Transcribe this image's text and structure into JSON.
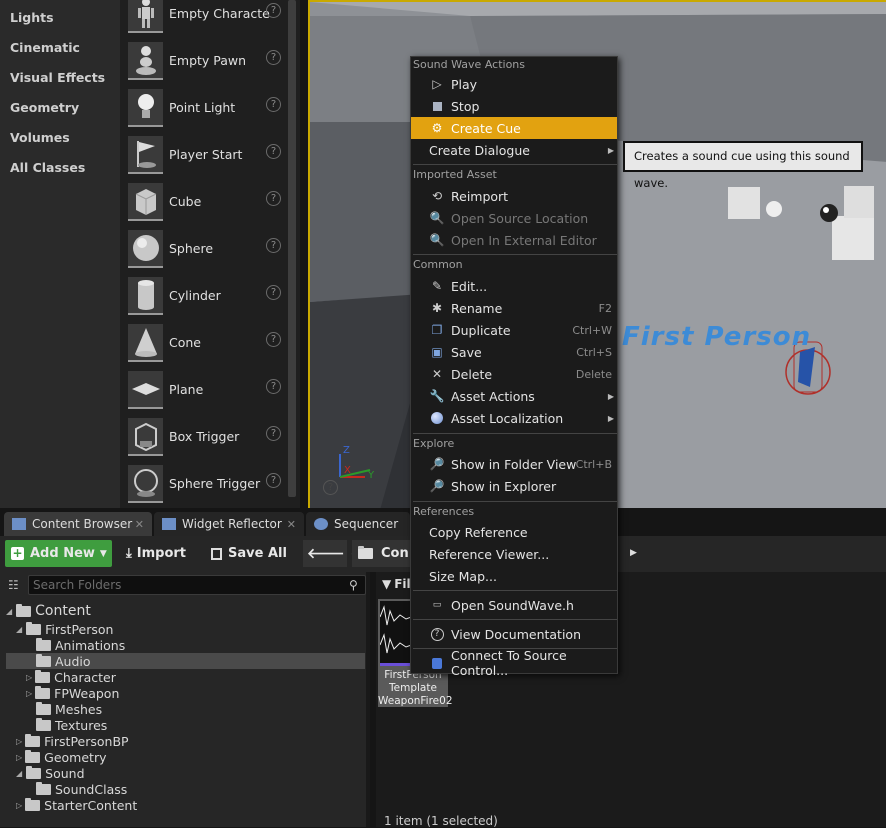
{
  "categories": [
    "Lights",
    "Cinematic",
    "Visual Effects",
    "Geometry",
    "Volumes",
    "All Classes"
  ],
  "place_items": [
    {
      "label": "Empty Characte",
      "icon": "character-icon"
    },
    {
      "label": "Empty Pawn",
      "icon": "pawn-icon"
    },
    {
      "label": "Point Light",
      "icon": "lightbulb-icon"
    },
    {
      "label": "Player Start",
      "icon": "flag-icon"
    },
    {
      "label": "Cube",
      "icon": "cube-icon"
    },
    {
      "label": "Sphere",
      "icon": "sphere-icon"
    },
    {
      "label": "Cylinder",
      "icon": "cylinder-icon"
    },
    {
      "label": "Cone",
      "icon": "cone-icon"
    },
    {
      "label": "Plane",
      "icon": "plane-icon"
    },
    {
      "label": "Box Trigger",
      "icon": "box-trigger-icon"
    },
    {
      "label": "Sphere Trigger",
      "icon": "sphere-trigger-icon"
    }
  ],
  "help_glyph": "?",
  "viewport": {
    "overlay_text": "First Person",
    "axis_x": "X",
    "axis_y": "Y",
    "axis_z": "Z"
  },
  "tabs": [
    {
      "label": "Content Browser",
      "close": "✕"
    },
    {
      "label": "Widget Reflector",
      "close": "✕"
    },
    {
      "label": "Sequencer"
    }
  ],
  "toolbar": {
    "add_new": "Add New",
    "import": "Import",
    "save_all": "Save All",
    "path_partial": "Con"
  },
  "folders": {
    "search_placeholder": "Search Folders",
    "tree": [
      {
        "label": "Content"
      },
      {
        "label": "FirstPerson"
      },
      {
        "label": "Animations"
      },
      {
        "label": "Audio",
        "selected": true
      },
      {
        "label": "Character"
      },
      {
        "label": "FPWeapon"
      },
      {
        "label": "Meshes"
      },
      {
        "label": "Textures"
      },
      {
        "label": "FirstPersonBP"
      },
      {
        "label": "Geometry"
      },
      {
        "label": "Sound"
      },
      {
        "label": "SoundClass"
      },
      {
        "label": "StarterContent"
      }
    ]
  },
  "assets": {
    "filter_label": "Filt",
    "asset_name_lines": [
      "FirstPerson",
      "Template",
      "WeaponFire02"
    ],
    "status": "1 item (1 selected)"
  },
  "menu": {
    "sections": {
      "sound_wave_actions": "Sound Wave Actions",
      "imported_asset": "Imported Asset",
      "common": "Common",
      "explore": "Explore",
      "references": "References"
    },
    "items": {
      "play": "Play",
      "stop": "Stop",
      "create_cue": "Create Cue",
      "create_dialogue": "Create Dialogue",
      "reimport": "Reimport",
      "open_source_location": "Open Source Location",
      "open_external_editor": "Open In External Editor",
      "edit": "Edit...",
      "rename": "Rename",
      "duplicate": "Duplicate",
      "save": "Save",
      "delete": "Delete",
      "asset_actions": "Asset Actions",
      "asset_localization": "Asset Localization",
      "show_in_folder_view": "Show in Folder View",
      "show_in_explorer": "Show in Explorer",
      "copy_reference": "Copy Reference",
      "reference_viewer": "Reference Viewer...",
      "size_map": "Size Map...",
      "open_soundwave_h": "Open SoundWave.h",
      "view_documentation": "View Documentation",
      "connect_source_control": "Connect To Source Control..."
    },
    "shortcuts": {
      "rename": "F2",
      "duplicate": "Ctrl+W",
      "save": "Ctrl+S",
      "delete": "Delete",
      "show_in_folder_view": "Ctrl+B"
    }
  },
  "tooltip": "Creates a sound cue using this sound wave.",
  "colors": {
    "accent": "#e2a210",
    "add_new_green": "#3f9d3f",
    "viewport_border": "#c9a900"
  }
}
